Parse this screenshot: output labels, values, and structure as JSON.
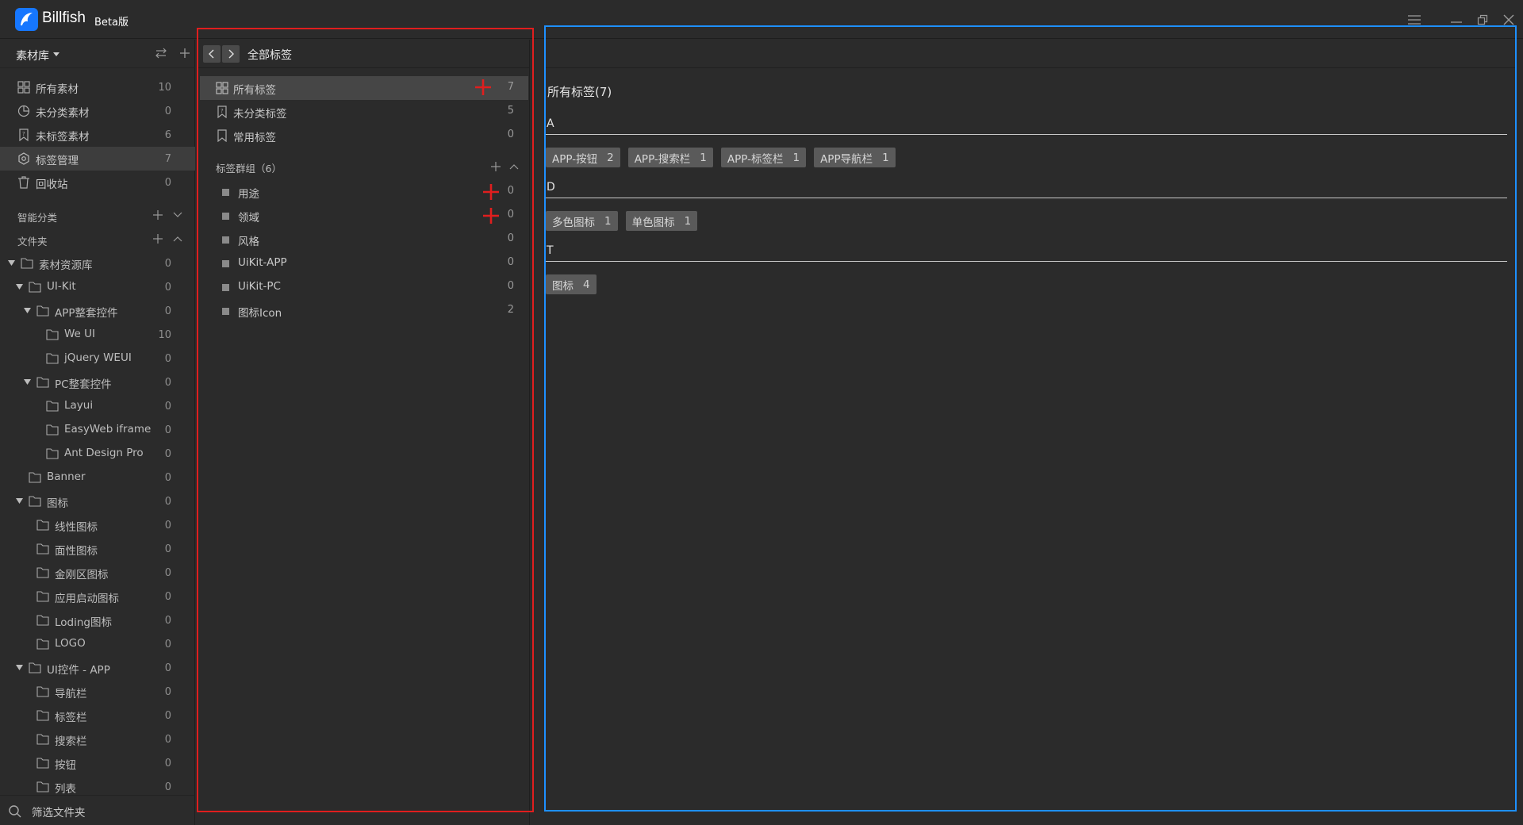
{
  "app": {
    "name": "Billfish",
    "badge": "Beta版"
  },
  "colors": {
    "accent": "#1e90ff",
    "annotation_red": "#e01e1e",
    "logo_blue": "#1677ff"
  },
  "sidebar": {
    "library_label": "素材库",
    "nav": [
      {
        "label": "所有素材",
        "count": "10",
        "icon": "grid-icon"
      },
      {
        "label": "未分类素材",
        "count": "0",
        "icon": "pie-icon"
      },
      {
        "label": "未标签素材",
        "count": "6",
        "icon": "tag-outline-icon"
      },
      {
        "label": "标签管理",
        "count": "7",
        "icon": "tag-manage-icon",
        "active": true
      },
      {
        "label": "回收站",
        "count": "0",
        "icon": "trash-icon"
      }
    ],
    "smart_label": "智能分类",
    "folder_label": "文件夹",
    "folders": [
      {
        "label": "素材资源库",
        "count": "0"
      },
      {
        "label": "UI-Kit",
        "count": "0"
      },
      {
        "label": "APP整套控件",
        "count": "0"
      },
      {
        "label": "We UI",
        "count": "10"
      },
      {
        "label": "jQuery WEUI",
        "count": "0"
      },
      {
        "label": "PC整套控件",
        "count": "0"
      },
      {
        "label": "Layui",
        "count": "0"
      },
      {
        "label": "EasyWeb iframe",
        "count": "0"
      },
      {
        "label": "Ant Design Pro",
        "count": "0"
      },
      {
        "label": "Banner",
        "count": "0"
      },
      {
        "label": "图标",
        "count": "0"
      },
      {
        "label": "线性图标",
        "count": "0"
      },
      {
        "label": "面性图标",
        "count": "0"
      },
      {
        "label": "金刚区图标",
        "count": "0"
      },
      {
        "label": "应用启动图标",
        "count": "0"
      },
      {
        "label": "Loding图标",
        "count": "0"
      },
      {
        "label": "LOGO",
        "count": "0"
      },
      {
        "label": "UI控件 - APP",
        "count": "0"
      },
      {
        "label": "导航栏",
        "count": "0"
      },
      {
        "label": "标签栏",
        "count": "0"
      },
      {
        "label": "搜索栏",
        "count": "0"
      },
      {
        "label": "按钮",
        "count": "0"
      },
      {
        "label": "列表",
        "count": "0"
      }
    ],
    "filter_label": "筛选文件夹"
  },
  "tagpanel": {
    "title": "全部标签",
    "items": [
      {
        "label": "所有标签",
        "count": "7"
      },
      {
        "label": "未分类标签",
        "count": "5"
      },
      {
        "label": "常用标签",
        "count": "0"
      }
    ],
    "group_title": "标签群组（6）",
    "groups": [
      {
        "label": "用途",
        "count": "0"
      },
      {
        "label": "领域",
        "count": "0"
      },
      {
        "label": "风格",
        "count": "0"
      },
      {
        "label": "UiKit-APP",
        "count": "0"
      },
      {
        "label": "UiKit-PC",
        "count": "0"
      },
      {
        "label": "图标Icon",
        "count": "2"
      }
    ]
  },
  "content": {
    "title": "所有标签(7)",
    "sections": [
      {
        "letter": "A",
        "tags": [
          {
            "name": "APP-按钮",
            "count": "2"
          },
          {
            "name": "APP-搜索栏",
            "count": "1"
          },
          {
            "name": "APP-标签栏",
            "count": "1"
          },
          {
            "name": "APP导航栏",
            "count": "1"
          }
        ]
      },
      {
        "letter": "D",
        "tags": [
          {
            "name": "多色图标",
            "count": "1"
          },
          {
            "name": "单色图标",
            "count": "1"
          }
        ]
      },
      {
        "letter": "T",
        "tags": [
          {
            "name": "图标",
            "count": "4"
          }
        ]
      }
    ]
  }
}
